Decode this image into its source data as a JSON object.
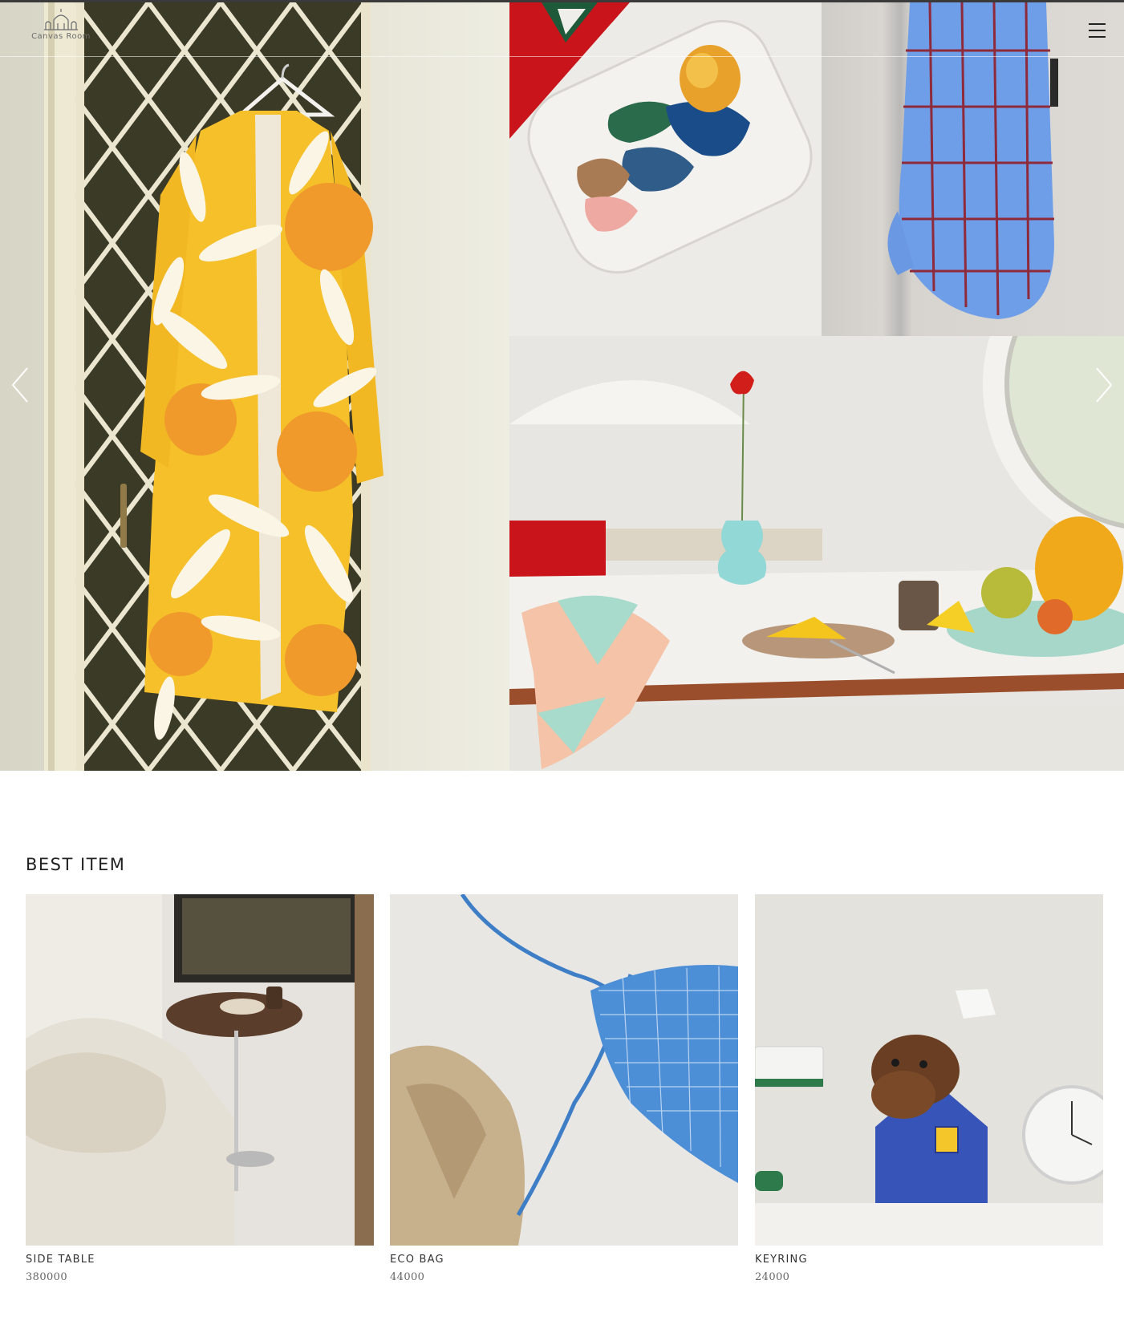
{
  "header": {
    "logo_text": "Canvas Room",
    "menu_icon": "hamburger-icon"
  },
  "hero": {
    "prev_icon": "chevron-left-icon",
    "next_icon": "chevron-right-icon",
    "slides": [
      "robe",
      "plate",
      "oven-mitt",
      "table-setting"
    ]
  },
  "best_item": {
    "title": "BEST ITEM",
    "products": [
      {
        "name": "SIDE TABLE",
        "price": "380000"
      },
      {
        "name": "ECO BAG",
        "price": "44000"
      },
      {
        "name": "KEYRING",
        "price": "24000"
      }
    ]
  },
  "colors": {
    "robe_yellow": "#f5c02a",
    "petal_white": "#fbf5e6",
    "sun_orange": "#ef9a2b",
    "mitt_blue": "#6f9ee8",
    "mitt_grid": "#8f2a3a",
    "accent_red": "#c8141a"
  }
}
